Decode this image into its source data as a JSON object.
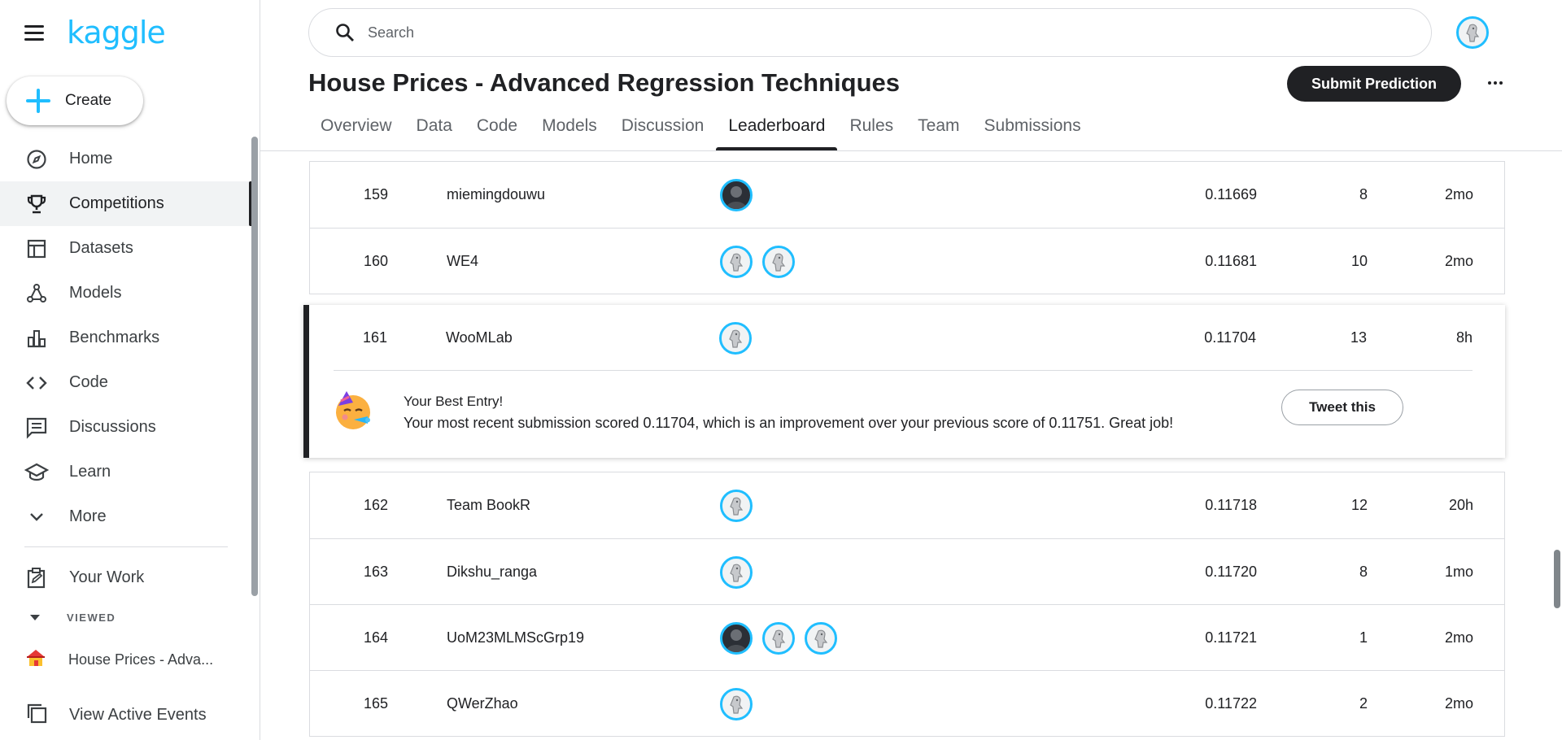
{
  "brand": {
    "logo_text": "kaggle"
  },
  "sidebar": {
    "create_label": "Create",
    "items": [
      {
        "label": "Home",
        "icon": "compass-icon"
      },
      {
        "label": "Competitions",
        "icon": "trophy-icon",
        "active": true
      },
      {
        "label": "Datasets",
        "icon": "table-icon"
      },
      {
        "label": "Models",
        "icon": "models-icon"
      },
      {
        "label": "Benchmarks",
        "icon": "bar-chart-icon"
      },
      {
        "label": "Code",
        "icon": "code-icon"
      },
      {
        "label": "Discussions",
        "icon": "comment-icon"
      },
      {
        "label": "Learn",
        "icon": "school-icon"
      },
      {
        "label": "More",
        "icon": "chevron-down-icon"
      }
    ],
    "your_work_label": "Your Work",
    "viewed_label": "VIEWED",
    "recent_item": "House Prices - Adva...",
    "active_events_label": "View Active Events"
  },
  "search": {
    "placeholder": "Search"
  },
  "competition": {
    "title": "House Prices - Advanced Regression Techniques",
    "submit_label": "Submit Prediction"
  },
  "tabs": [
    "Overview",
    "Data",
    "Code",
    "Models",
    "Discussion",
    "Leaderboard",
    "Rules",
    "Team",
    "Submissions"
  ],
  "active_tab": "Leaderboard",
  "leaderboard": {
    "rows_above": [
      {
        "rank": "159",
        "team": "miemingdouwu",
        "avatars": [
          "dark"
        ],
        "score": "0.11669",
        "entries": "8",
        "last": "2mo"
      },
      {
        "rank": "160",
        "team": "WE4",
        "avatars": [
          "default",
          "default"
        ],
        "score": "0.11681",
        "entries": "10",
        "last": "2mo"
      }
    ],
    "highlight": {
      "rank": "161",
      "team": "WooMLab",
      "avatars": [
        "default"
      ],
      "score": "0.11704",
      "entries": "13",
      "last": "8h"
    },
    "best_entry": {
      "title": "Your Best Entry!",
      "message": "Your most recent submission scored 0.11704, which is an improvement over your previous score of 0.11751. Great job!",
      "tweet_label": "Tweet this"
    },
    "rows_below": [
      {
        "rank": "162",
        "team": "Team BookR",
        "avatars": [
          "default"
        ],
        "score": "0.11718",
        "entries": "12",
        "last": "20h"
      },
      {
        "rank": "163",
        "team": "Dikshu_ranga",
        "avatars": [
          "default"
        ],
        "score": "0.11720",
        "entries": "8",
        "last": "1mo"
      },
      {
        "rank": "164",
        "team": "UoM23MLMScGrp19",
        "avatars": [
          "dark",
          "default",
          "default"
        ],
        "score": "0.11721",
        "entries": "1",
        "last": "2mo"
      },
      {
        "rank": "165",
        "team": "QWerZhao",
        "avatars": [
          "default"
        ],
        "score": "0.11722",
        "entries": "2",
        "last": "2mo"
      }
    ]
  },
  "colors": {
    "accent": "#20beff",
    "dark": "#202124",
    "border": "#dadce0"
  }
}
